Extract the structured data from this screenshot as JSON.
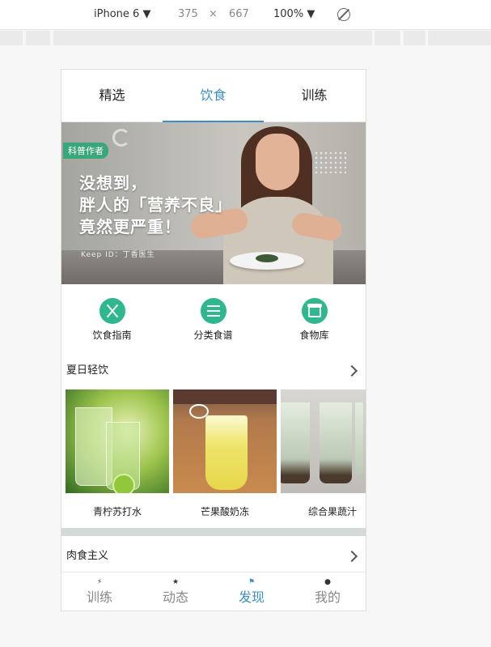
{
  "devtools": {
    "device": "iPhone 6",
    "device_caret": "▼",
    "width": "375",
    "times": "×",
    "height": "667",
    "zoom": "100%",
    "zoom_caret": "▼"
  },
  "top_tabs": [
    {
      "label": "精选"
    },
    {
      "label": "饮食"
    },
    {
      "label": "训练"
    }
  ],
  "banner": {
    "badge": "科普作者",
    "headline_1": "没想到，",
    "headline_2": "胖人的「营养不良」",
    "headline_3": "竟然更严重！",
    "author": "Keep ID：丁香医生"
  },
  "categories": [
    {
      "label": "饮食指南",
      "icon": "fork-knife-icon"
    },
    {
      "label": "分类食谱",
      "icon": "menu-list-icon"
    },
    {
      "label": "食物库",
      "icon": "food-box-icon"
    }
  ],
  "section_summer": {
    "title": "夏日轻饮"
  },
  "drinks": [
    {
      "label": "青柠苏打水"
    },
    {
      "label": "芒果酸奶冻"
    },
    {
      "label": "综合果蔬汁"
    }
  ],
  "section_meat": {
    "title": "肉食主义"
  },
  "bottom_nav": [
    {
      "label": "训练",
      "icon": "⚡"
    },
    {
      "label": "动态",
      "icon": "★"
    },
    {
      "label": "发现",
      "icon": "⚑"
    },
    {
      "label": "我的",
      "icon": "●"
    }
  ],
  "colors": {
    "accent": "#3b8fc6",
    "green": "#2fb88e"
  }
}
